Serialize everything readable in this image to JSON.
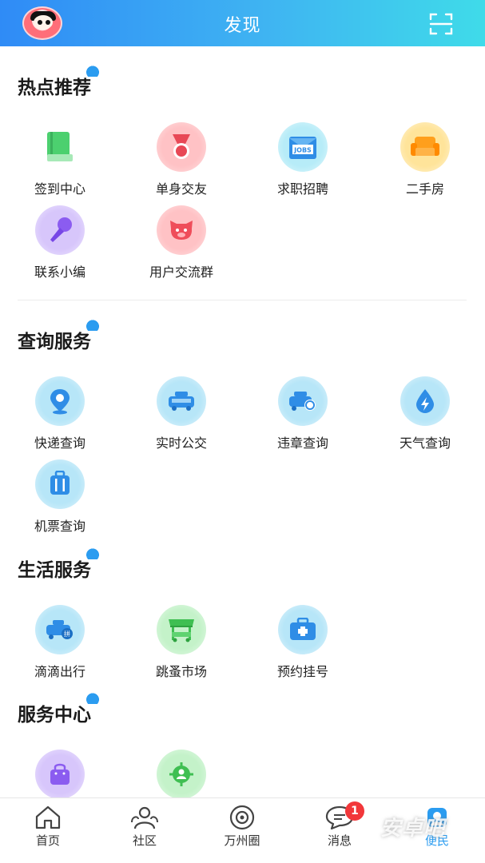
{
  "header": {
    "title": "发现",
    "avatar_icon": "avatar-icon",
    "scan_icon": "scan-icon"
  },
  "sections": {
    "hot": {
      "title": "热点推荐",
      "items": [
        {
          "label": "签到中心",
          "icon": "book-icon",
          "color": "#3fc468"
        },
        {
          "label": "单身交友",
          "icon": "medal-icon",
          "color": "#f05a66"
        },
        {
          "label": "求职招聘",
          "icon": "jobs-icon",
          "color": "#2b8fe8"
        },
        {
          "label": "二手房",
          "icon": "sofa-icon",
          "color": "#ff9a1f"
        },
        {
          "label": "联系小编",
          "icon": "microphone-icon",
          "color": "#8b5cf0"
        },
        {
          "label": "用户交流群",
          "icon": "pig-icon",
          "color": "#f0505c"
        }
      ]
    },
    "query": {
      "title": "查询服务",
      "items": [
        {
          "label": "快递查询",
          "icon": "location-pin-icon",
          "color": "#2b8fe8"
        },
        {
          "label": "实时公交",
          "icon": "bus-icon",
          "color": "#2b8fe8"
        },
        {
          "label": "违章查询",
          "icon": "car-search-icon",
          "color": "#2b8fe8"
        },
        {
          "label": "天气查询",
          "icon": "bolt-drop-icon",
          "color": "#2b8fe8"
        },
        {
          "label": "机票查询",
          "icon": "luggage-icon",
          "color": "#2b8fe8"
        }
      ]
    },
    "life": {
      "title": "生活服务",
      "items": [
        {
          "label": "滴滴出行",
          "icon": "taxi-icon",
          "color": "#2b8fe8"
        },
        {
          "label": "跳蚤市场",
          "icon": "market-stall-icon",
          "color": "#3fbf52"
        },
        {
          "label": "预约挂号",
          "icon": "medical-case-icon",
          "color": "#2b8fe8"
        }
      ]
    },
    "center": {
      "title": "服务中心",
      "items": [
        {
          "label": "",
          "icon": "shopping-bag-icon",
          "color": "#8b5cf0"
        },
        {
          "label": "",
          "icon": "target-user-icon",
          "color": "#3fbf52"
        }
      ]
    }
  },
  "tabbar": {
    "tabs": [
      {
        "label": "首页",
        "icon": "home-icon"
      },
      {
        "label": "社区",
        "icon": "community-icon"
      },
      {
        "label": "万州圈",
        "icon": "circle-icon"
      },
      {
        "label": "消息",
        "icon": "message-icon",
        "badge": "1"
      },
      {
        "label": "便民",
        "icon": "convenience-icon"
      }
    ]
  },
  "watermark": "安卓吧"
}
